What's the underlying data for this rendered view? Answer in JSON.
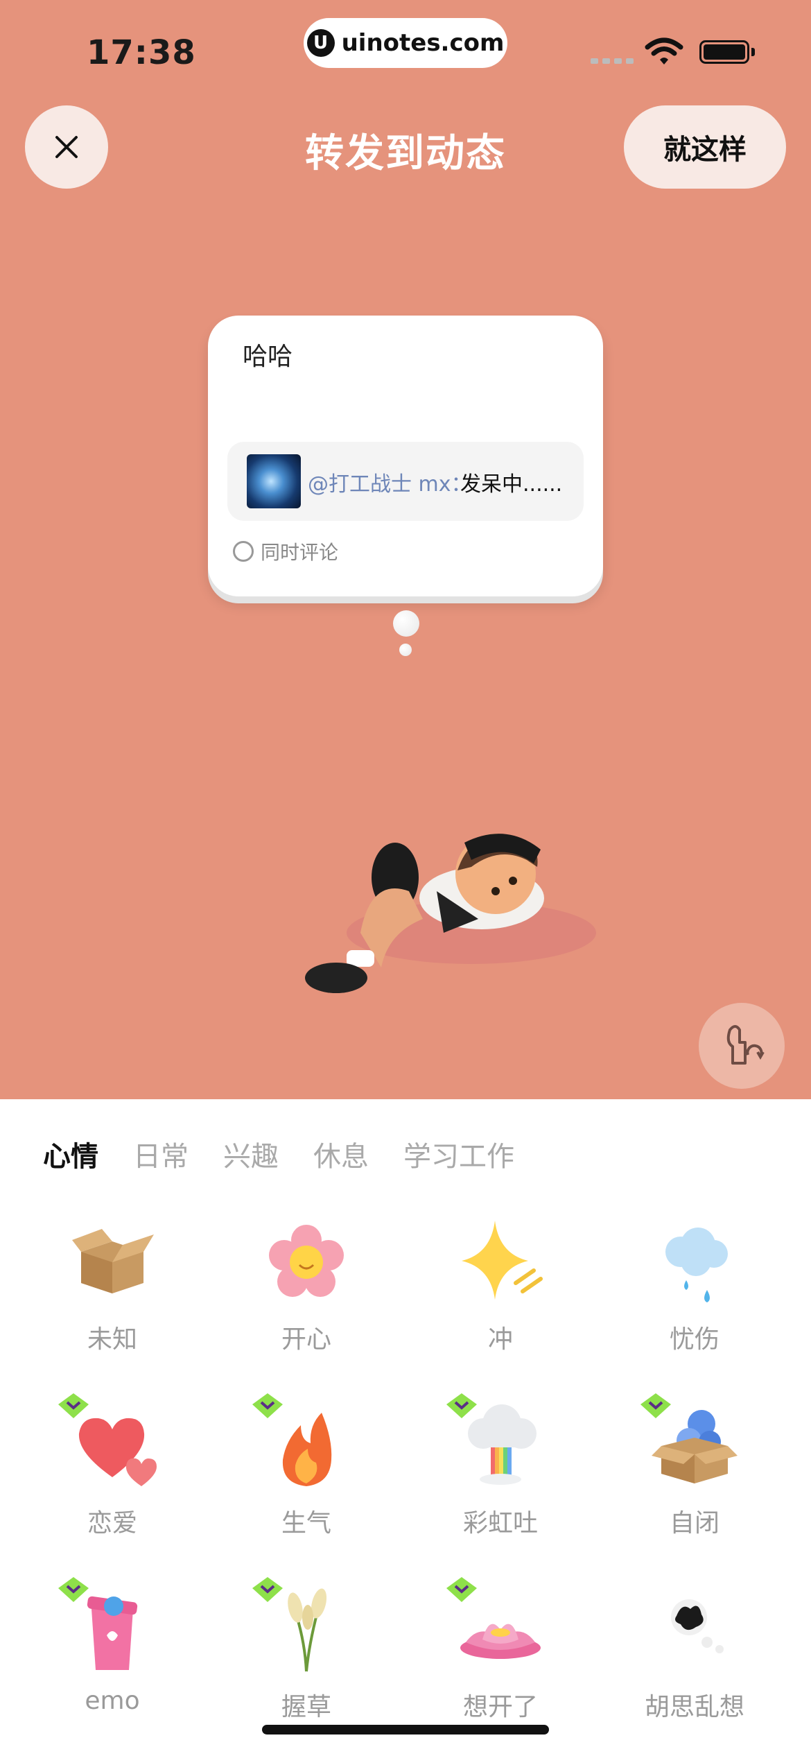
{
  "status_bar": {
    "time": "17:38",
    "url": "uinotes.com"
  },
  "header": {
    "title": "转发到动态",
    "done_label": "就这样"
  },
  "post": {
    "text": "哈哈",
    "quote_user": "@打工战士 mx：",
    "quote_text": "发呆中......",
    "comment_label": "同时评论"
  },
  "tabs": [
    {
      "label": "心情",
      "active": true
    },
    {
      "label": "日常",
      "active": false
    },
    {
      "label": "兴趣",
      "active": false
    },
    {
      "label": "休息",
      "active": false
    },
    {
      "label": "学习工作",
      "active": false
    }
  ],
  "moods": [
    {
      "label": "未知",
      "icon": "box-icon",
      "badge": false
    },
    {
      "label": "开心",
      "icon": "flower-icon",
      "badge": false
    },
    {
      "label": "冲",
      "icon": "sparkle-icon",
      "badge": false
    },
    {
      "label": "忧伤",
      "icon": "rain-cloud-icon",
      "badge": false
    },
    {
      "label": "恋爱",
      "icon": "hearts-icon",
      "badge": true
    },
    {
      "label": "生气",
      "icon": "fire-icon",
      "badge": true
    },
    {
      "label": "彩虹吐",
      "icon": "rainbow-cloud-icon",
      "badge": true
    },
    {
      "label": "自闭",
      "icon": "box-balls-icon",
      "badge": true
    },
    {
      "label": "emo",
      "icon": "trash-bin-icon",
      "badge": true
    },
    {
      "label": "握草",
      "icon": "grass-icon",
      "badge": true
    },
    {
      "label": "想开了",
      "icon": "lotus-icon",
      "badge": true
    },
    {
      "label": "胡思乱想",
      "icon": "scribble-cloud-icon",
      "badge": false
    }
  ],
  "colors": {
    "background": "#E5937C",
    "sheet": "#FFFFFF",
    "badge": "#8EE04A"
  }
}
